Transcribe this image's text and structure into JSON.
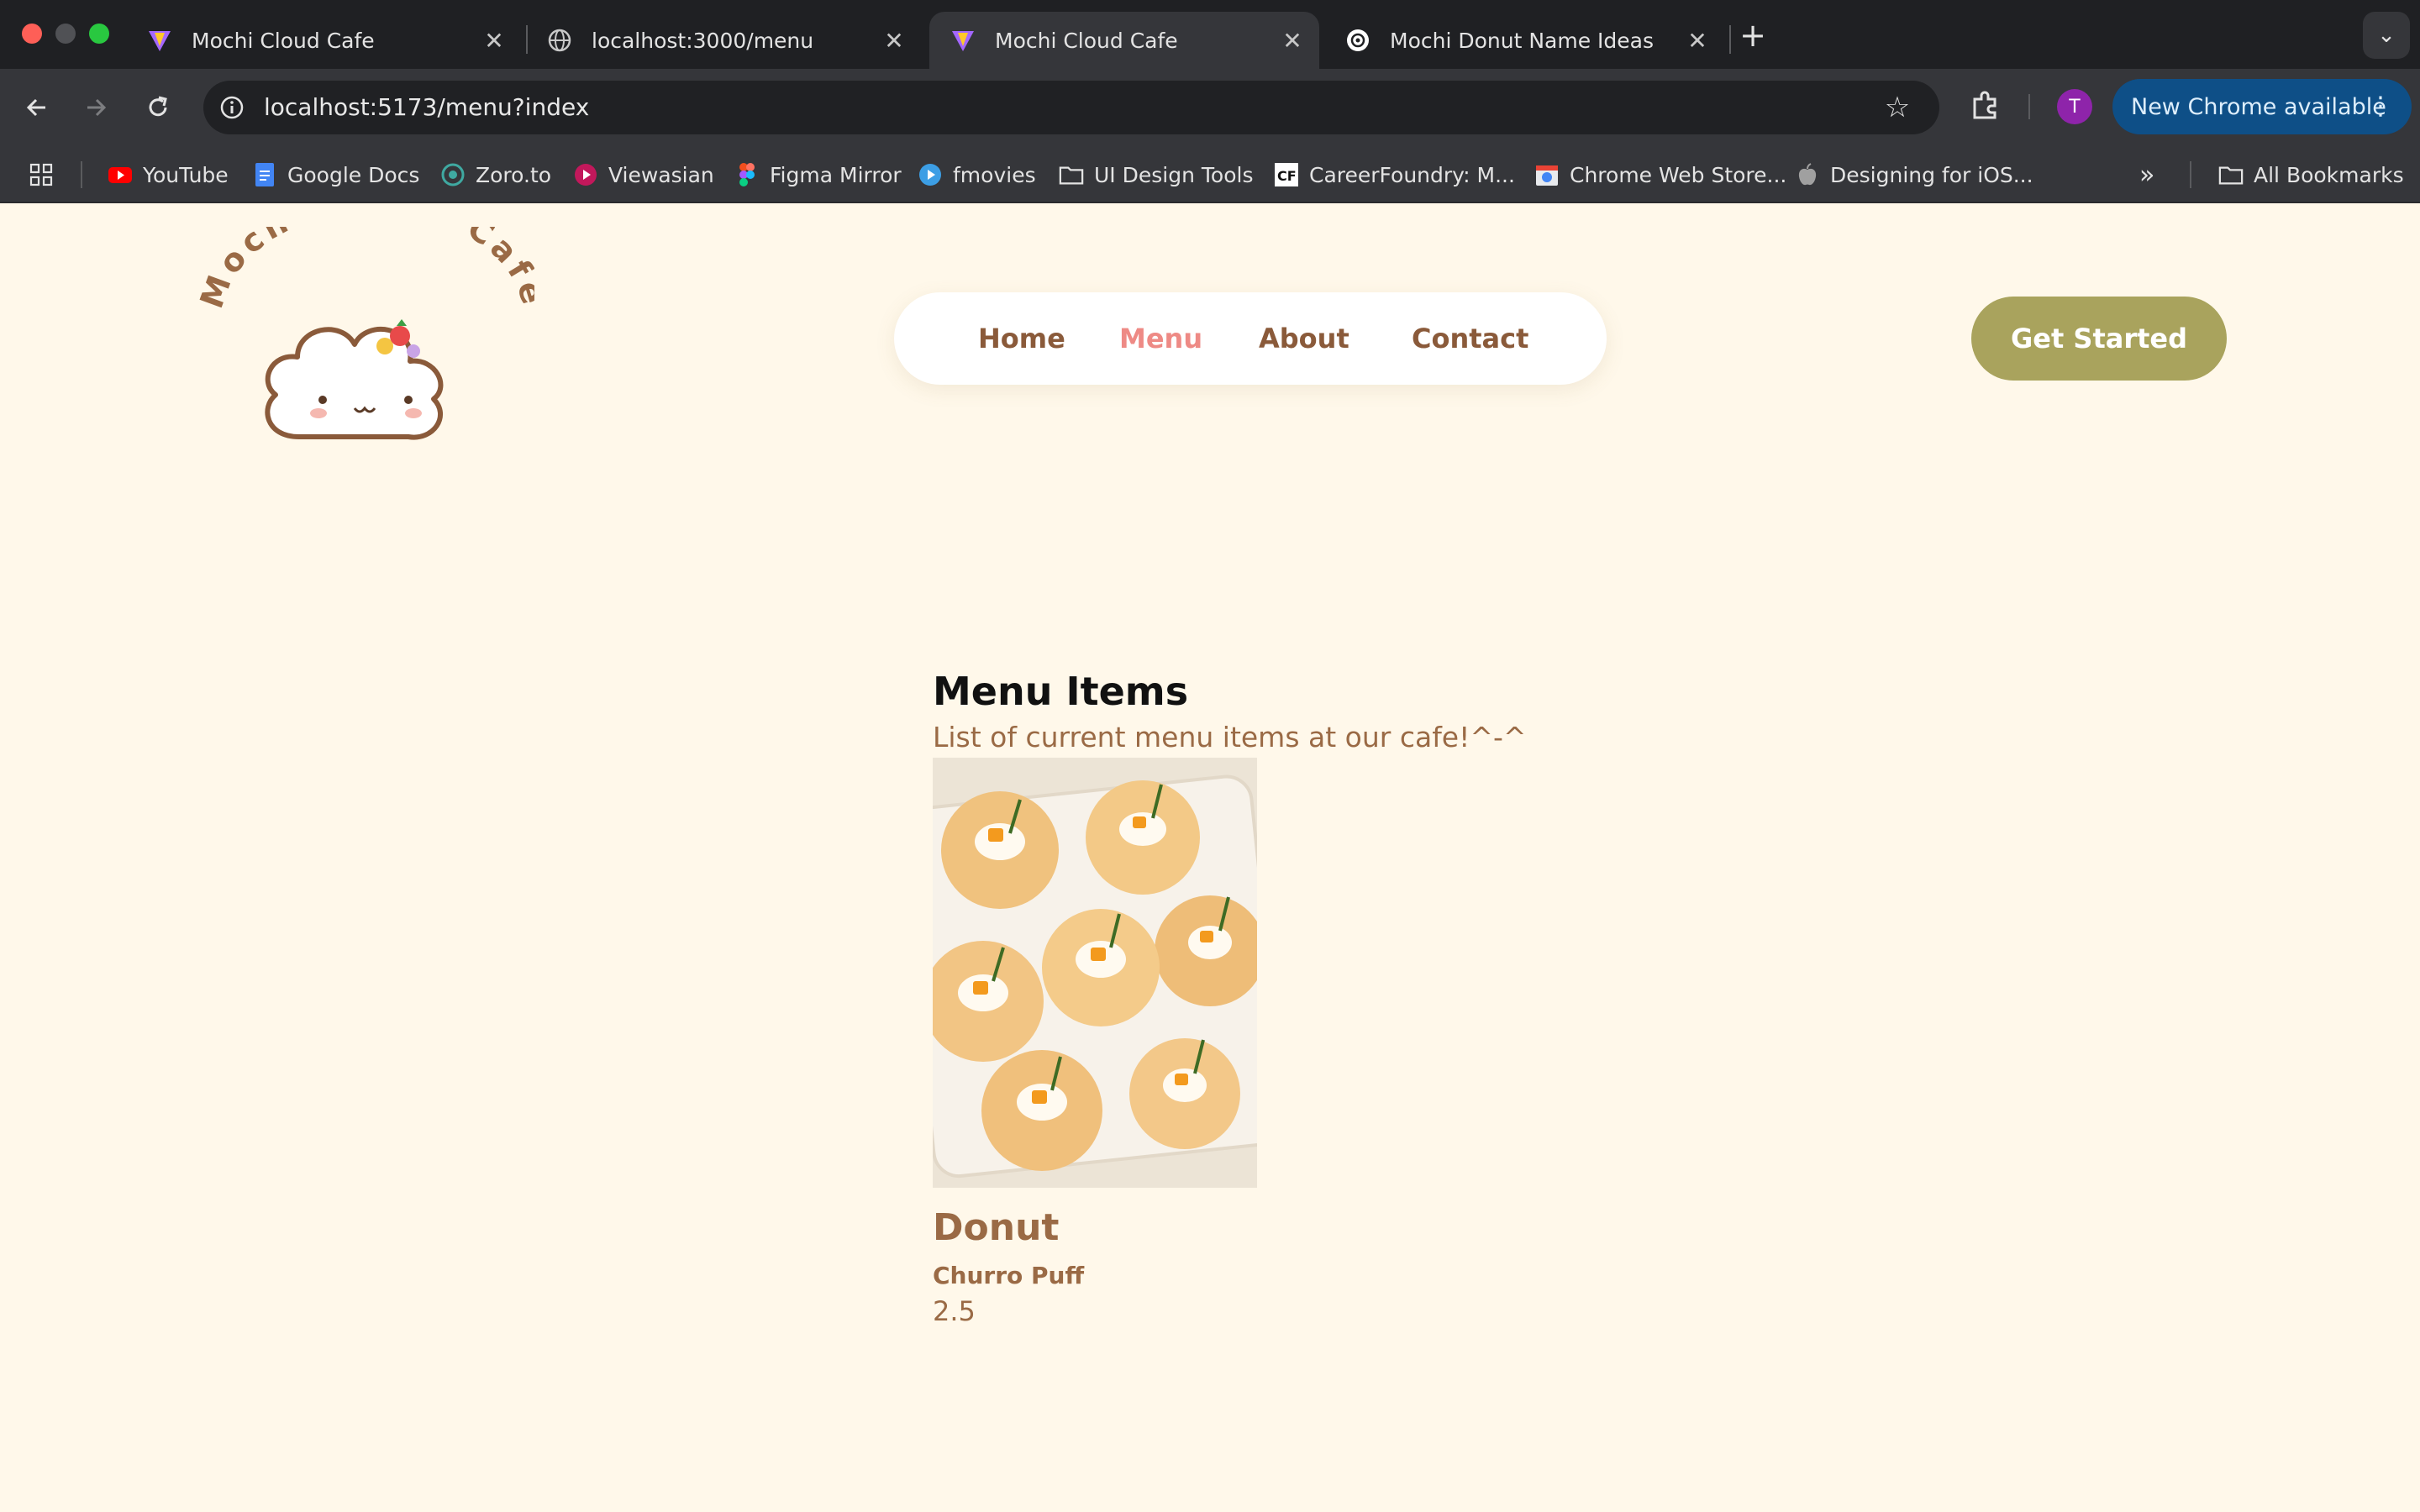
{
  "browser": {
    "tabs": [
      {
        "title": "Mochi Cloud Cafe",
        "icon": "vite-icon",
        "active": false
      },
      {
        "title": "localhost:3000/menu",
        "icon": "globe-icon",
        "active": false
      },
      {
        "title": "Mochi Cloud Cafe",
        "icon": "vite-icon",
        "active": true
      },
      {
        "title": "Mochi Donut Name Ideas",
        "icon": "chatgpt-icon",
        "active": false
      }
    ],
    "url": "localhost:5173/menu?index",
    "profile_initial": "T",
    "update_label": "New Chrome available",
    "bookmarks": [
      {
        "label": "YouTube",
        "icon": "youtube-icon"
      },
      {
        "label": "Google Docs",
        "icon": "docs-icon"
      },
      {
        "label": "Zoro.to",
        "icon": "zoro-icon"
      },
      {
        "label": "Viewasian",
        "icon": "play-icon"
      },
      {
        "label": "Figma Mirror",
        "icon": "figma-icon"
      },
      {
        "label": "fmovies",
        "icon": "fmovies-icon"
      },
      {
        "label": "UI Design Tools",
        "icon": "folder-icon"
      },
      {
        "label": "CareerFoundry: M...",
        "icon": "careerfoundry-icon"
      },
      {
        "label": "Chrome Web Store...",
        "icon": "webstore-icon"
      },
      {
        "label": "Designing for iOS...",
        "icon": "apple-icon"
      }
    ],
    "all_bookmarks_label": "All Bookmarks"
  },
  "site": {
    "logo_text": "Mochi Cloud Cafe",
    "nav": [
      {
        "label": "Home",
        "active": false
      },
      {
        "label": "Menu",
        "active": true
      },
      {
        "label": "About",
        "active": false
      },
      {
        "label": "Contact",
        "active": false
      }
    ],
    "cta_label": "Get Started"
  },
  "menu": {
    "title": "Menu Items",
    "subtitle": "List of current menu items at our cafe!^-^",
    "items": [
      {
        "category": "Donut",
        "name": "Churro Puff",
        "price": "2.5"
      }
    ]
  },
  "colors": {
    "page_bg": "#fff8ea",
    "brand_brown": "#9a6a45",
    "nav_active": "#ee8a85",
    "cta_bg": "#a9a35d"
  }
}
